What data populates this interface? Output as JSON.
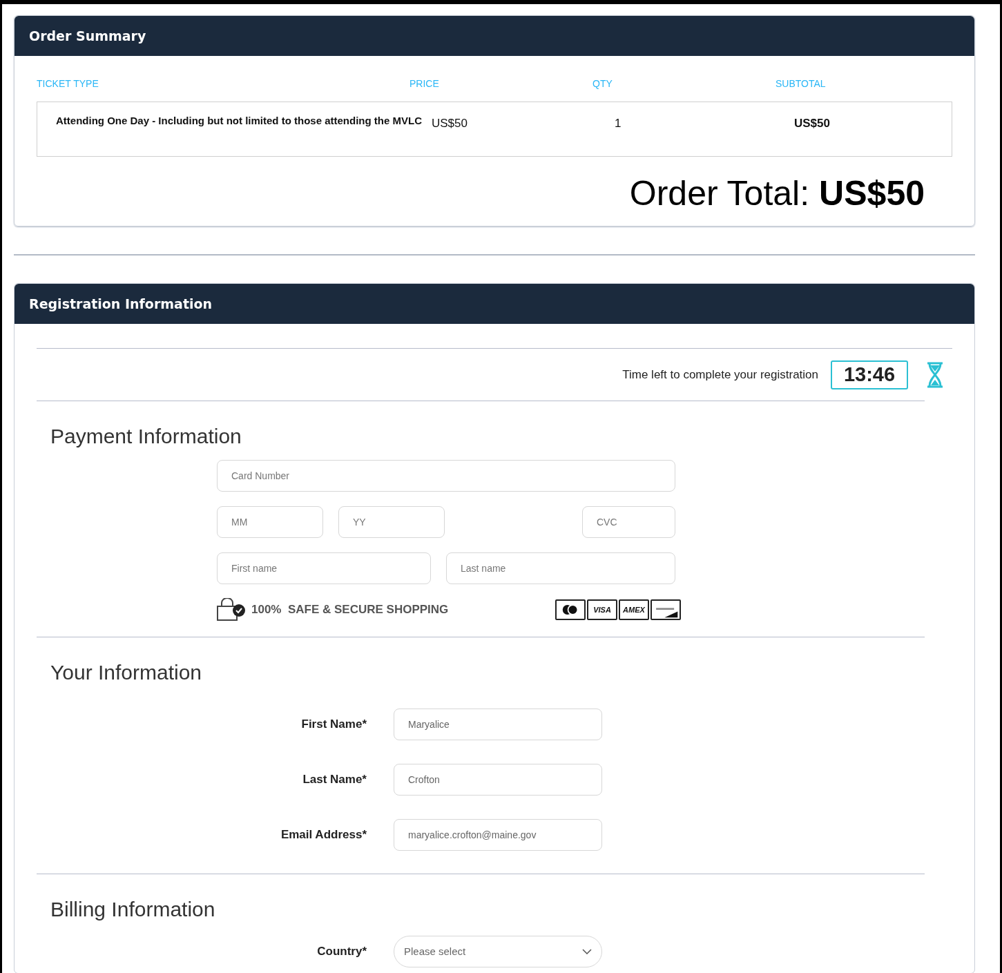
{
  "order_summary": {
    "title": "Order Summary",
    "columns": [
      "TICKET TYPE",
      "PRICE",
      "QTY",
      "SUBTOTAL"
    ],
    "rows": [
      {
        "ticket_type": "Attending One Day - Including but not limited to those attending the MVLC",
        "price": "US$50",
        "qty": "1",
        "subtotal": "US$50"
      }
    ],
    "total_label": "Order Total:",
    "total_value": "US$50"
  },
  "registration": {
    "title": "Registration Information",
    "timer_label": "Time left to complete your registration",
    "timer_value": "13:46",
    "payment": {
      "title": "Payment Information",
      "fields": [
        {
          "placeholder": "Card Number"
        },
        {
          "placeholder": "MM"
        },
        {
          "placeholder": "YY"
        },
        {
          "placeholder": "CVC"
        },
        {
          "placeholder": "First name"
        },
        {
          "placeholder": "Last name"
        }
      ],
      "secure_text": "100%  SAFE & SECURE SHOPPING",
      "card_logos": [
        {
          "kind": "circles"
        },
        {
          "kind": "text",
          "label": "VISA"
        },
        {
          "kind": "text",
          "label": "AMEX"
        },
        {
          "kind": "discover"
        }
      ]
    },
    "your_info": {
      "title": "Your Information",
      "fields": [
        {
          "label": "First Name*",
          "value": "Maryalice"
        },
        {
          "label": "Last Name*",
          "value": "Crofton"
        },
        {
          "label": "Email Address*",
          "value": "maryalice.crofton@maine.gov"
        }
      ]
    },
    "billing": {
      "title": "Billing Information",
      "fields": [
        {
          "kind": "select",
          "label": "Country*",
          "placeholder": "Please select"
        }
      ]
    }
  }
}
